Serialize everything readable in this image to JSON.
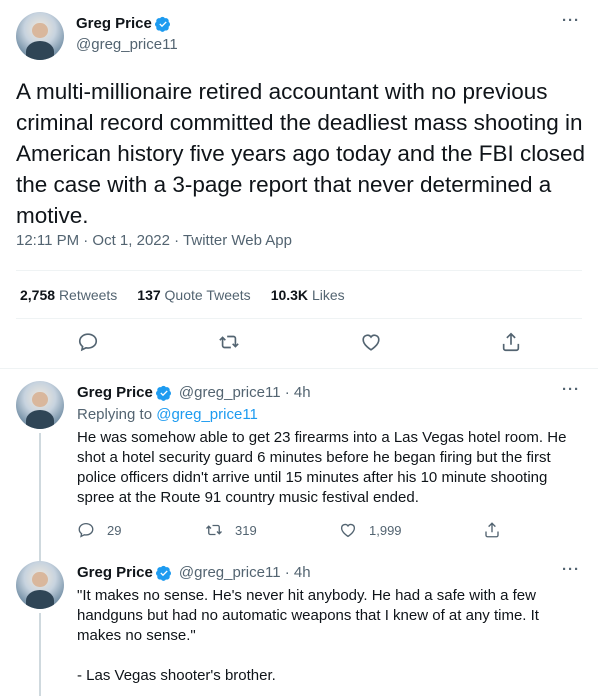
{
  "main_tweet": {
    "display_name": "Greg Price",
    "handle": "@greg_price11",
    "text": "A multi-millionaire retired accountant with no previous criminal record committed the deadliest mass shooting in American history five years ago today and the FBI closed the case with a 3-page report that never determined a motive.",
    "time": "12:11 PM · Oct 1, 2022 · Twitter Web App",
    "retweets_count": "2,758",
    "retweets_label": "Retweets",
    "quote_count": "137",
    "quote_label": "Quote Tweets",
    "likes_count": "10.3K",
    "likes_label": "Likes"
  },
  "replies": [
    {
      "display_name": "Greg Price",
      "handle_time": "@greg_price11 · 4h",
      "replying_prefix": "Replying to",
      "replying_to": "@greg_price11",
      "text": "He was somehow able to get 23 firearms into a Las Vegas hotel room. He shot a hotel security guard 6 minutes before he began firing but the first police officers didn't arrive until 15 minutes after his 10 minute shooting spree at the Route 91 country music festival ended.",
      "reply_count": "29",
      "retweet_count": "319",
      "like_count": "1,999"
    },
    {
      "display_name": "Greg Price",
      "handle_time": "@greg_price11 · 4h",
      "text": "\"It makes no sense. He's never hit anybody. He had a safe with a few handguns but had no automatic weapons that I knew of at any time. It makes no sense.\"\n\n- Las Vegas shooter's brother."
    }
  ],
  "more_label": "···",
  "colors": {
    "accent": "#1d9bf0",
    "muted": "#536471",
    "text": "#0f1419"
  }
}
